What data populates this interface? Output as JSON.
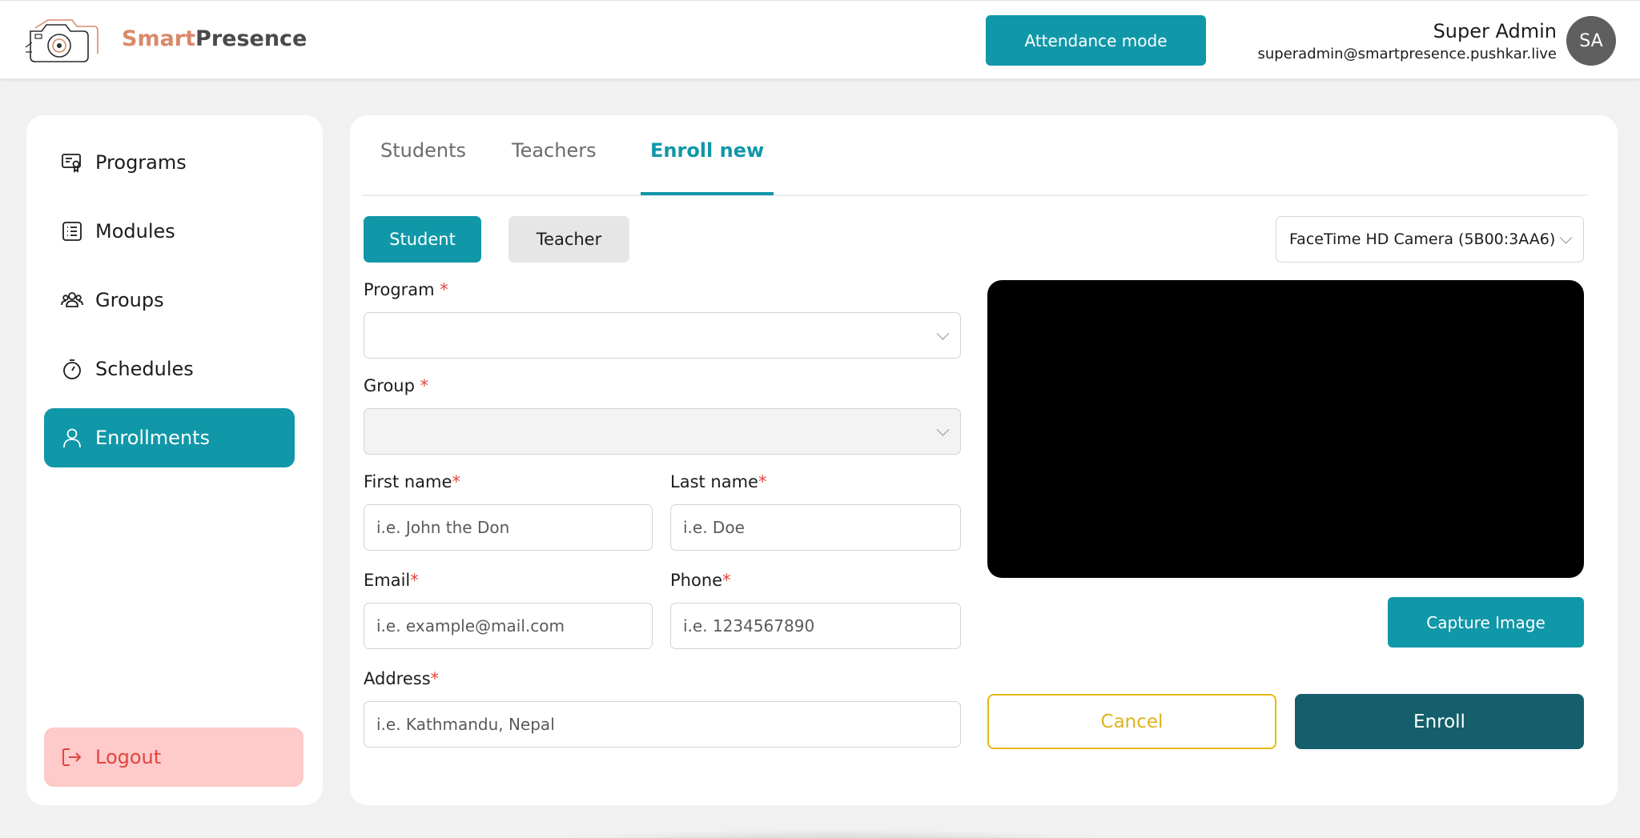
{
  "header": {
    "brand_part1": "Smart",
    "brand_part2": "Presence",
    "attendance_label": "Attendance mode",
    "user_name": "Super Admin",
    "user_email": "superadmin@smartpresence.pushkar.live",
    "avatar_initials": "SA"
  },
  "sidebar": {
    "items": [
      {
        "label": "Programs",
        "icon": "certificate-icon"
      },
      {
        "label": "Modules",
        "icon": "list-icon"
      },
      {
        "label": "Groups",
        "icon": "users-icon"
      },
      {
        "label": "Schedules",
        "icon": "stopwatch-icon"
      },
      {
        "label": "Enrollments",
        "icon": "user-icon",
        "active": true
      }
    ],
    "logout_label": "Logout"
  },
  "tabs": [
    {
      "label": "Students"
    },
    {
      "label": "Teachers"
    },
    {
      "label": "Enroll new",
      "active": true
    }
  ],
  "form": {
    "role_student": "Student",
    "role_teacher": "Teacher",
    "camera_value": "FaceTime HD Camera (5B00:3AA6)",
    "program_label": "Program",
    "group_label": "Group",
    "first_name_label": "First name",
    "first_name_placeholder": "i.e. John the Don",
    "last_name_label": "Last name",
    "last_name_placeholder": "i.e. Doe",
    "email_label": "Email",
    "email_placeholder": "i.e. example@mail.com",
    "phone_label": "Phone",
    "phone_placeholder": "i.e. 1234567890",
    "address_label": "Address",
    "address_placeholder": "i.e. Kathmandu, Nepal",
    "required_mark": "*",
    "capture_label": "Capture Image",
    "cancel_label": "Cancel",
    "enroll_label": "Enroll"
  },
  "colors": {
    "accent": "#1097a8",
    "enroll": "#145f6b",
    "cancel": "#e8b812",
    "logout_bg": "#ffcaca",
    "logout_text": "#e2453e"
  }
}
